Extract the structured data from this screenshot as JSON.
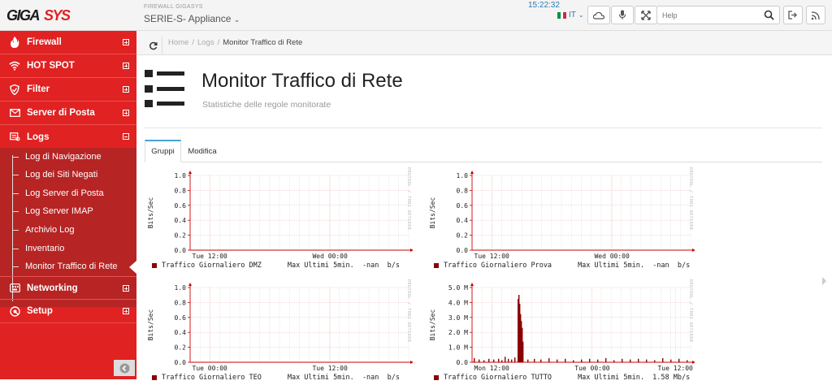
{
  "header": {
    "logo_text": "GIGASYS",
    "brand_small": "FIREWALL GIGASYS",
    "appliance": "SERIE-S- Appliance",
    "clock": "15:22:32",
    "lang": "IT",
    "search_placeholder": "Help",
    "icons": [
      "cloud-icon",
      "microphone-icon",
      "fullscreen-icon",
      "search-icon",
      "logout-icon",
      "signal-icon"
    ]
  },
  "sidebar": {
    "items": [
      {
        "label": "Firewall",
        "icon": "flame-icon",
        "expanded": false
      },
      {
        "label": "HOT SPOT",
        "icon": "wifi-icon",
        "expanded": false
      },
      {
        "label": "Filter",
        "icon": "shield-icon",
        "expanded": false
      },
      {
        "label": "Server di Posta",
        "icon": "mail-icon",
        "expanded": false
      },
      {
        "label": "Logs",
        "icon": "logs-icon",
        "expanded": true
      },
      {
        "label": "Networking",
        "icon": "network-icon",
        "expanded": false
      },
      {
        "label": "Setup",
        "icon": "setup-icon",
        "expanded": false
      }
    ],
    "logs_submenu": [
      "Log di Navigazione",
      "Log dei Siti Negati",
      "Log Server di Posta",
      "Log Server IMAP",
      "Archivio Log",
      "Inventario",
      "Monitor Traffico di Rete"
    ],
    "active_submenu": "Monitor Traffico di Rete"
  },
  "breadcrumb": {
    "home": "Home",
    "sep": "/",
    "logs": "Logs",
    "current": "Monitor Traffico di Rete"
  },
  "page": {
    "title": "Monitor Traffico di Rete",
    "subtitle": "Statistiche delle regole monitorate"
  },
  "tabs": [
    {
      "label": "Gruppi",
      "active": true
    },
    {
      "label": "Modifica",
      "active": false
    }
  ],
  "graphs": [
    {
      "ylabel": "Bits/Sec",
      "yticks": [
        "1.0",
        "0.8",
        "0.6",
        "0.4",
        "0.2",
        "0.0"
      ],
      "xticks": [
        "Tue 12:00",
        "Wed 00:00"
      ],
      "legend": "Traffico Giornaliero DMZ",
      "stat": "Max Ultimi 5min.  -nan  b/s",
      "side": "RRDTOOL / TOBI OETIKER"
    },
    {
      "ylabel": "Bits/Sec",
      "yticks": [
        "1.0",
        "0.8",
        "0.6",
        "0.4",
        "0.2",
        "0.0"
      ],
      "xticks": [
        "Tue 12:00",
        "Wed 00:00"
      ],
      "legend": "Traffico Giornaliero Prova",
      "stat": "Max Ultimi 5min.  -nan  b/s",
      "side": "RRDTOOL / TOBI OETIKER"
    },
    {
      "ylabel": "Bits/Sec",
      "yticks": [
        "1.0",
        "0.8",
        "0.6",
        "0.4",
        "0.2",
        "0.0"
      ],
      "xticks": [
        "Tue 00:00",
        "Tue 12:00"
      ],
      "legend": "Traffico Giornaliero TEO",
      "stat": "Max Ultimi 5min.  -nan  b/s",
      "side": "RRDTOOL / TOBI OETIKER"
    },
    {
      "ylabel": "Bits/Sec",
      "yticks": [
        "5.0 M",
        "4.0 M",
        "3.0 M",
        "2.0 M",
        "1.0 M",
        "0.0"
      ],
      "xticks": [
        "Mon 12:00",
        "Tue 00:00",
        "Tue 12:00"
      ],
      "legend": "Traffico Giornaliero TUTTO",
      "stat": "Max Ultimi 5min.  1.58 Mb/s",
      "side": "RRDTOOL / TOBI OETIKER"
    }
  ],
  "colors": {
    "sidebar": "#e02222",
    "sidebar_sub": "#b72424",
    "series": "#8b0000",
    "accent": "#4aa0d8"
  }
}
